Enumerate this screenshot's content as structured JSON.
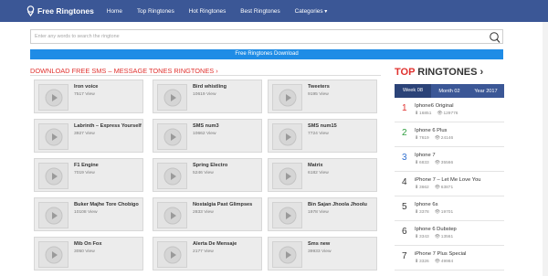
{
  "nav": {
    "brand": "Free Ringtones",
    "links": [
      "Home",
      "Top Ringtones",
      "Hot Ringtones",
      "Best Ringtones",
      "Categories"
    ]
  },
  "search": {
    "placeholder": "Enter any words to search the ringtone"
  },
  "download_bar": "Free Ringtones Download",
  "section_heading": "DOWNLOAD FREE SMS – MESSAGE TONES RINGTONES ›",
  "cards": [
    {
      "title": "Iron voice",
      "views": "7517 View"
    },
    {
      "title": "Bird whistling",
      "views": "10619 View"
    },
    {
      "title": "Tweeters",
      "views": "9195 View"
    },
    {
      "title": "Labrinth – Express Yourself",
      "views": "3927 View"
    },
    {
      "title": "SMS num3",
      "views": "10662 View"
    },
    {
      "title": "SMS num15",
      "views": "7724 View"
    },
    {
      "title": "F1 Engine",
      "views": "7019 View"
    },
    {
      "title": "Spring Electro",
      "views": "5246 View"
    },
    {
      "title": "Matrix",
      "views": "6182 View"
    },
    {
      "title": "Buker Majhe Tore Chobigo",
      "views": "10108 View"
    },
    {
      "title": "Nostalgia Past Glimpses",
      "views": "2833 View"
    },
    {
      "title": "Bin Sajan Jhoola Jhoolu",
      "views": "1978 View"
    },
    {
      "title": "Mib On Fox",
      "views": "3050 View"
    },
    {
      "title": "Alerta De Mensaje",
      "views": "2177 View"
    },
    {
      "title": "Sms new",
      "views": "39933 View"
    }
  ],
  "sidebar": {
    "heading_red": "TOP",
    "heading_dark": "RINGTONES",
    "heading_chevron": "›",
    "tabs": [
      "Week 08",
      "Month 02",
      "Year 2017"
    ],
    "items": [
      {
        "rank": "1",
        "title": "Iphone6 Original",
        "downloads": "16851",
        "views": "129776",
        "rank_color": "#e0322f"
      },
      {
        "rank": "2",
        "title": "Iphone 6 Plus",
        "downloads": "7619",
        "views": "24146",
        "rank_color": "#2e9e3e"
      },
      {
        "rank": "3",
        "title": "Iphone 7",
        "downloads": "6833",
        "views": "35566",
        "rank_color": "#2f6fd0"
      },
      {
        "rank": "4",
        "title": "iPhone 7 – Let Me Love You",
        "downloads": "3662",
        "views": "63871",
        "rank_color": "#333333"
      },
      {
        "rank": "5",
        "title": "Iphone 6s",
        "downloads": "3378",
        "views": "19701",
        "rank_color": "#333333"
      },
      {
        "rank": "6",
        "title": "Iphone 6 Dubstep",
        "downloads": "3343",
        "views": "13561",
        "rank_color": "#333333"
      },
      {
        "rank": "7",
        "title": "iPhone 7 Plus Special",
        "downloads": "3326",
        "views": "49984",
        "rank_color": "#333333"
      }
    ]
  }
}
